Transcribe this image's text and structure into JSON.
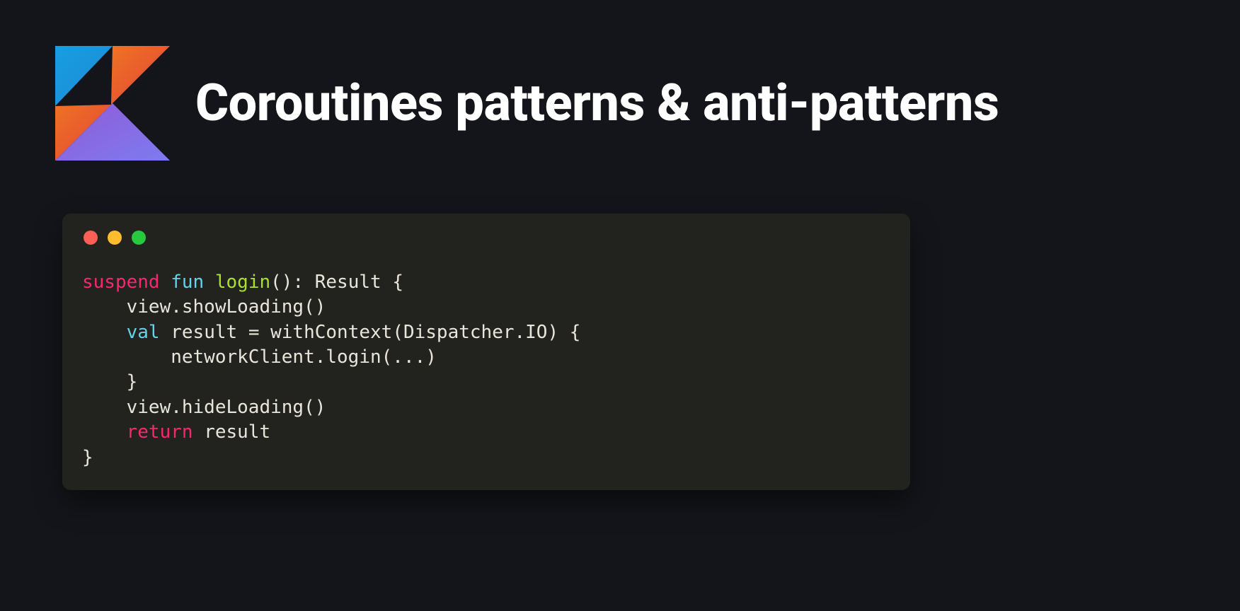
{
  "header": {
    "title": "Coroutines patterns & anti-patterns"
  },
  "logo": {
    "name": "kotlin-logo"
  },
  "code": {
    "tokens": {
      "suspend": "suspend",
      "fun": "fun",
      "login": "login",
      "sig_after_name": "(): Result {",
      "line2": "    view.showLoading()",
      "val": "val",
      "line3_rest": " result = withContext(Dispatcher.IO) {",
      "line4": "        networkClient.login(...)",
      "line5": "    }",
      "line6": "    view.hideLoading()",
      "return": "return",
      "line7_rest": " result",
      "line8": "}"
    }
  },
  "colors": {
    "bg": "#14151a",
    "panel": "#22231e",
    "text": "#e8e6db",
    "keyword_pink": "#f92672",
    "keyword_cyan": "#63d3e9",
    "fn_green": "#a6e22e",
    "dot_red": "#ff5f56",
    "dot_yellow": "#ffbd2e",
    "dot_green": "#27c93f"
  }
}
